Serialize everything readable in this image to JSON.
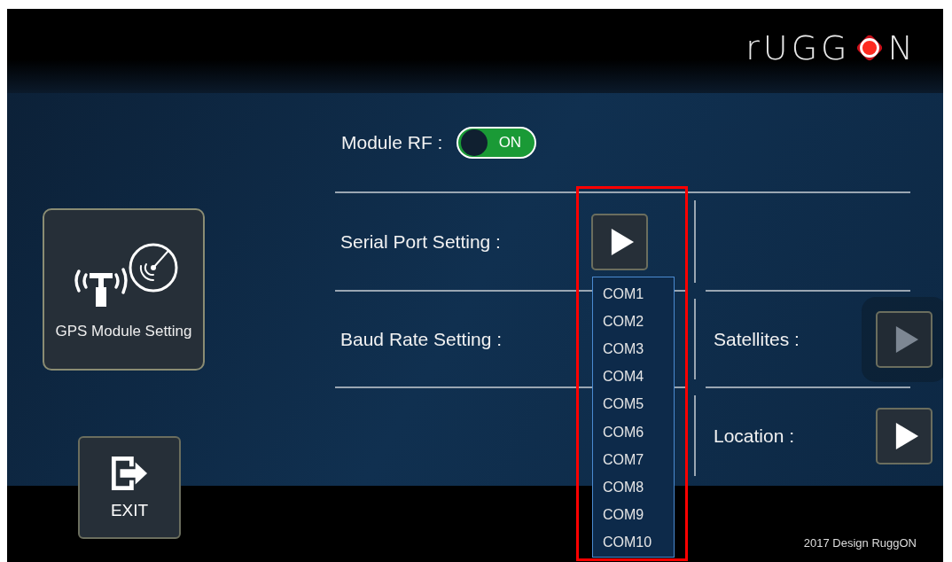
{
  "logo": {
    "left": "rUGG",
    "right": "N"
  },
  "module_rf": {
    "label": "Module RF :",
    "toggle": {
      "on": true,
      "label": "ON"
    }
  },
  "settings": [
    {
      "label": "Serial Port Setting :",
      "kind": "button",
      "disabled": false
    },
    {
      "label": "Baud Rate Setting :",
      "kind": "text"
    }
  ],
  "info": [
    {
      "label": "Satellites :",
      "disabled": true
    },
    {
      "label": "Location :",
      "disabled": false
    }
  ],
  "dropdown": {
    "items": [
      "COM1",
      "COM2",
      "COM3",
      "COM4",
      "COM5",
      "COM6",
      "COM7",
      "COM8",
      "COM9",
      "COM10"
    ]
  },
  "sidebar": {
    "gps_button": "GPS Module Setting",
    "exit_button": "EXIT"
  },
  "footer": "2017 Design RuggON"
}
